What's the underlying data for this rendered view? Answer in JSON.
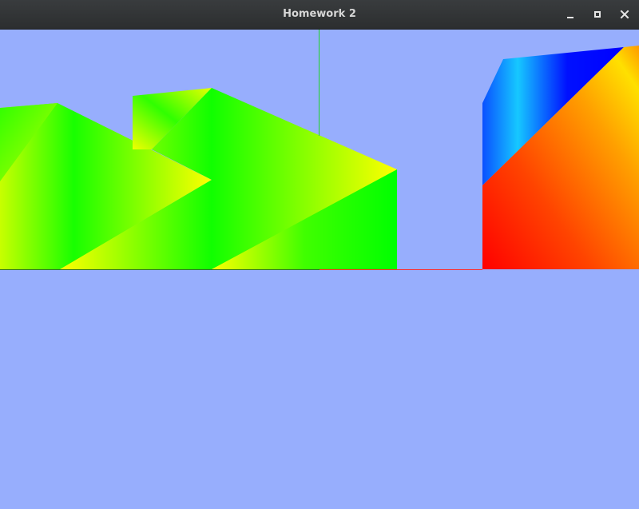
{
  "window": {
    "title": "Homework 2"
  },
  "controls": {
    "minimize_icon": "minimize-icon",
    "maximize_icon": "maximize-icon",
    "close_icon": "close-icon"
  },
  "scene": {
    "background_color": "#97aefd",
    "axis_colors": {
      "x": "#ff2a2a",
      "y": "#1fd12a"
    },
    "shape_colors": [
      "#00ff00",
      "#ffff00",
      "#0000ff",
      "#ff0000",
      "#ff8800",
      "#00c8ff"
    ]
  }
}
